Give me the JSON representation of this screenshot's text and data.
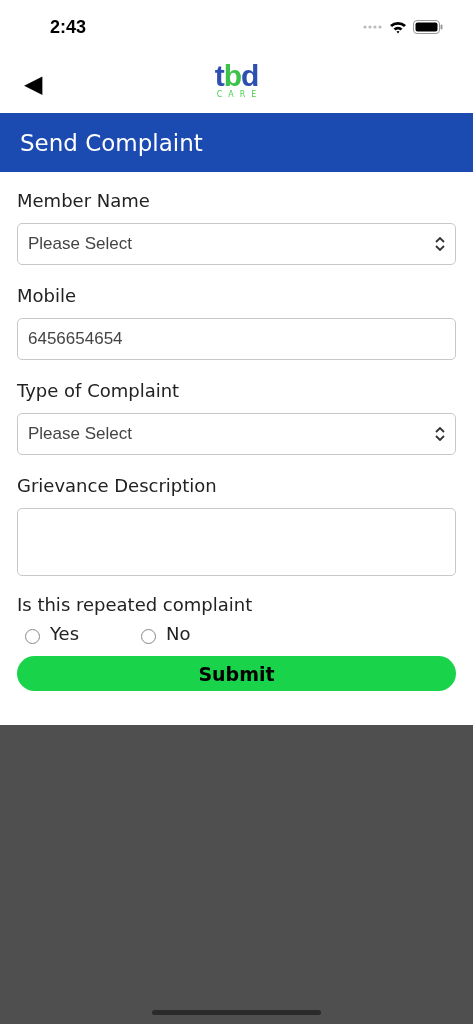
{
  "status_bar": {
    "time": "2:43"
  },
  "nav": {
    "back": "◀",
    "logo": "tbd",
    "logo_sub": "CARE"
  },
  "header": {
    "title": "Send Complaint"
  },
  "fields": [
    {
      "label": "Member Name",
      "kind": "select",
      "placeholder": "Please Select"
    },
    {
      "label": "Mobile",
      "kind": "text",
      "value": "6456654654"
    },
    {
      "label": "Type of Complaint",
      "kind": "select",
      "placeholder": "Please Select"
    },
    {
      "label": "Grievance Description",
      "kind": "textarea"
    }
  ],
  "question": {
    "label": "Is this repeated complaint",
    "options": [
      {
        "label": "Yes",
        "selected": false
      },
      {
        "label": "No",
        "selected": false
      }
    ]
  },
  "submit": "Submit"
}
